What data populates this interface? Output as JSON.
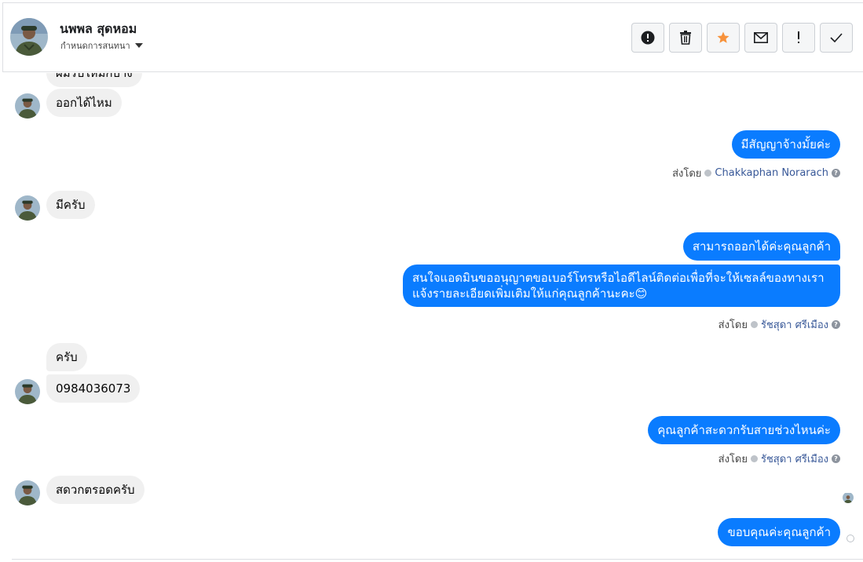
{
  "header": {
    "name": "นพพล สุดหอม",
    "assign_label": "กำหนดการสนทนา",
    "toolbar": [
      {
        "name": "spam-button",
        "icon": "alert-circle-icon"
      },
      {
        "name": "delete-button",
        "icon": "trash-icon"
      },
      {
        "name": "star-button",
        "icon": "star-icon"
      },
      {
        "name": "mark-unread-button",
        "icon": "envelope-icon"
      },
      {
        "name": "follow-up-button",
        "icon": "exclamation-icon"
      },
      {
        "name": "mark-done-button",
        "icon": "check-icon"
      }
    ]
  },
  "messages": {
    "partial_top": "ผมรับใหม่กี่บ้าง",
    "m1": "ออกได้ไหม",
    "m2": "มีสัญญาจ้างมั้ยค่ะ",
    "sent1_prefix": "ส่งโดย",
    "sent1_name": "Chakkaphan Norarach",
    "m3": "มีครับ",
    "m4": "สามารถออกได้ค่ะคุณลูกค้า",
    "m5": "สนใจแอดมินขออนุญาตขอเบอร์โทรหรือไอดีไลน์ติดต่อเพื่อที่จะให้เซลล์ของทางเราแจ้งรายละเอียดเพิ่มเติมให้แก่คุณลูกค้านะคะ😊",
    "sent2_prefix": "ส่งโดย",
    "sent2_name": "รัชสุดา ศรีเมือง",
    "m6": "ครับ",
    "m7": "0984036073",
    "m8": "คุณลูกค้าสะดวกรับสายช่วงไหนค่ะ",
    "sent3_prefix": "ส่งโดย",
    "sent3_name": "รัชสุดา ศรีเมือง",
    "m9": "สดวกตรอดครับ",
    "m10": "ขอบคุณค่ะคุณลูกค้า"
  },
  "colors": {
    "outgoing": "#0a7cff",
    "incoming": "#f0f0f0",
    "star": "#f7923b",
    "link_name": "#385898"
  }
}
